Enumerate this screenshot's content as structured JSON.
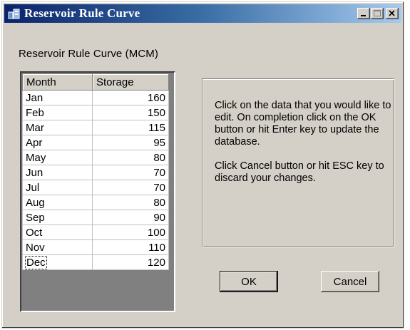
{
  "window": {
    "title": "Reservoir Rule Curve"
  },
  "caption": "Reservoir Rule Curve (MCM)",
  "grid": {
    "columns": [
      "Month",
      "Storage"
    ],
    "rows": [
      {
        "month": "Jan",
        "storage": "160"
      },
      {
        "month": "Feb",
        "storage": "150"
      },
      {
        "month": "Mar",
        "storage": "115"
      },
      {
        "month": "Apr",
        "storage": "95"
      },
      {
        "month": "May",
        "storage": "80"
      },
      {
        "month": "Jun",
        "storage": "70"
      },
      {
        "month": "Jul",
        "storage": "70"
      },
      {
        "month": "Aug",
        "storage": "80"
      },
      {
        "month": "Sep",
        "storage": "90"
      },
      {
        "month": "Oct",
        "storage": "100"
      },
      {
        "month": "Nov",
        "storage": "110"
      },
      {
        "month": "Dec",
        "storage": "120"
      }
    ]
  },
  "info": {
    "paragraph1": "Click on the data that you would like to edit. On completion click on the OK button or hit Enter key to update the database.",
    "paragraph2": "Click Cancel button or hit ESC key to discard your changes."
  },
  "buttons": {
    "ok": "OK",
    "cancel": "Cancel"
  },
  "colors": {
    "titlebar_start": "#0a246a",
    "titlebar_end": "#a6caf0",
    "dialog_face": "#d4d0c8"
  }
}
